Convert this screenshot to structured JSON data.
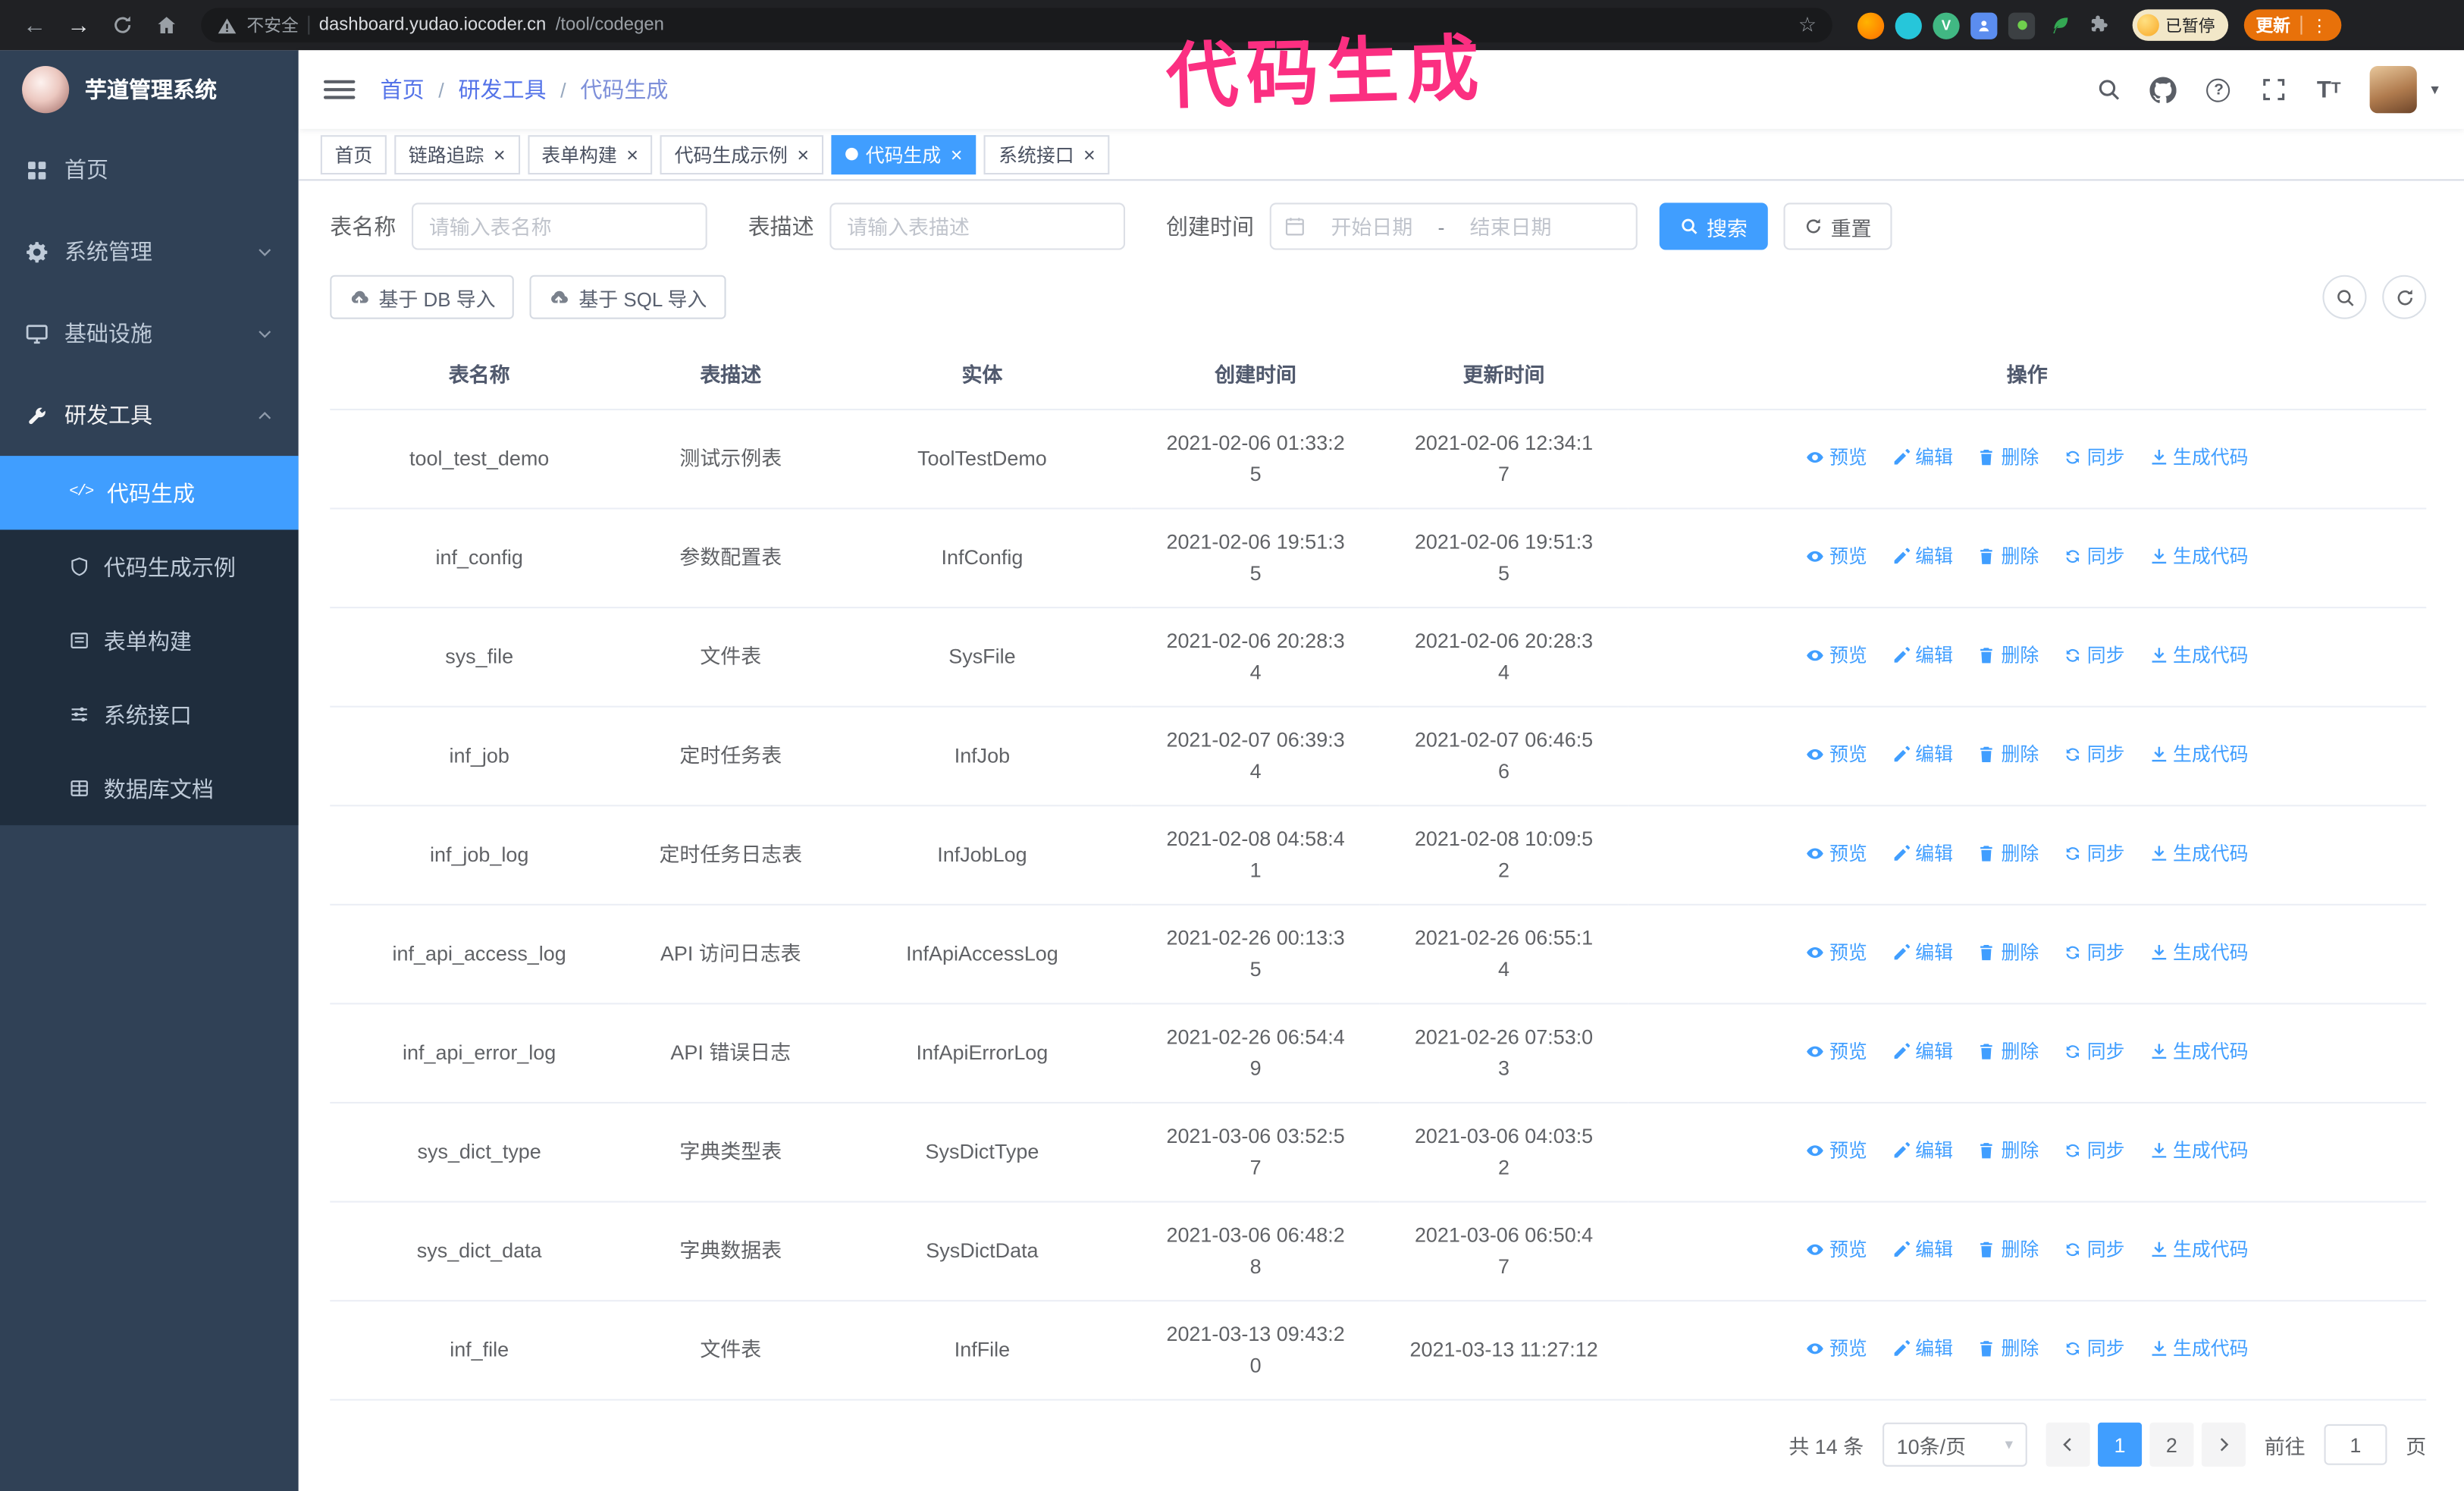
{
  "annotation": {
    "text": "代码生成"
  },
  "browser": {
    "security_label": "不安全",
    "url_host": "dashboard.yudao.iocoder.cn",
    "url_path": "/tool/codegen",
    "paused_badge_label": "已暂停",
    "update_button_label": "更新"
  },
  "icons": {
    "close_glyph": "×",
    "caret_down_glyph": "▾",
    "breadcrumb_separator": "/",
    "back_glyph": "←",
    "forward_glyph": "→",
    "kebab_glyph": "⋮",
    "star_glyph": "☆",
    "code_glyph": "</>"
  },
  "sidebar": {
    "logo_title": "芋道管理系统",
    "items": [
      {
        "label": "首页"
      },
      {
        "label": "系统管理"
      },
      {
        "label": "基础设施"
      },
      {
        "label": "研发工具"
      }
    ],
    "submenu": [
      {
        "label": "代码生成"
      },
      {
        "label": "代码生成示例"
      },
      {
        "label": "表单构建"
      },
      {
        "label": "系统接口"
      },
      {
        "label": "数据库文档"
      }
    ]
  },
  "topbar": {
    "breadcrumb": [
      "首页",
      "研发工具",
      "代码生成"
    ]
  },
  "tabs": [
    {
      "label": "首页"
    },
    {
      "label": "链路追踪"
    },
    {
      "label": "表单构建"
    },
    {
      "label": "代码生成示例"
    },
    {
      "label": "代码生成"
    },
    {
      "label": "系统接口"
    }
  ],
  "filters": {
    "table_name_label": "表名称",
    "table_name_placeholder": "请输入表名称",
    "table_desc_label": "表描述",
    "table_desc_placeholder": "请输入表描述",
    "create_time_label": "创建时间",
    "date_start_placeholder": "开始日期",
    "date_separator": "-",
    "date_end_placeholder": "结束日期",
    "search_button_label": "搜索",
    "reset_button_label": "重置"
  },
  "toolbar": {
    "import_db_label": "基于 DB 导入",
    "import_sql_label": "基于 SQL 导入"
  },
  "table": {
    "columns": [
      "表名称",
      "表描述",
      "实体",
      "创建时间",
      "更新时间",
      "操作"
    ],
    "actions": [
      "预览",
      "编辑",
      "删除",
      "同步",
      "生成代码"
    ],
    "rows": [
      {
        "name": "tool_test_demo",
        "desc": "测试示例表",
        "entity": "ToolTestDemo",
        "created": "2021-02-06 01:33:25",
        "updated": "2021-02-06 12:34:17"
      },
      {
        "name": "inf_config",
        "desc": "参数配置表",
        "entity": "InfConfig",
        "created": "2021-02-06 19:51:35",
        "updated": "2021-02-06 19:51:35"
      },
      {
        "name": "sys_file",
        "desc": "文件表",
        "entity": "SysFile",
        "created": "2021-02-06 20:28:34",
        "updated": "2021-02-06 20:28:34"
      },
      {
        "name": "inf_job",
        "desc": "定时任务表",
        "entity": "InfJob",
        "created": "2021-02-07 06:39:34",
        "updated": "2021-02-07 06:46:56"
      },
      {
        "name": "inf_job_log",
        "desc": "定时任务日志表",
        "entity": "InfJobLog",
        "created": "2021-02-08 04:58:41",
        "updated": "2021-02-08 10:09:52"
      },
      {
        "name": "inf_api_access_log",
        "desc": "API 访问日志表",
        "entity": "InfApiAccessLog",
        "created": "2021-02-26 00:13:35",
        "updated": "2021-02-26 06:55:14"
      },
      {
        "name": "inf_api_error_log",
        "desc": "API 错误日志",
        "entity": "InfApiErrorLog",
        "created": "2021-02-26 06:54:49",
        "updated": "2021-02-26 07:53:03"
      },
      {
        "name": "sys_dict_type",
        "desc": "字典类型表",
        "entity": "SysDictType",
        "created": "2021-03-06 03:52:57",
        "updated": "2021-03-06 04:03:52"
      },
      {
        "name": "sys_dict_data",
        "desc": "字典数据表",
        "entity": "SysDictData",
        "created": "2021-03-06 06:48:28",
        "updated": "2021-03-06 06:50:47"
      },
      {
        "name": "inf_file",
        "desc": "文件表",
        "entity": "InfFile",
        "created": "2021-03-13 09:43:20",
        "updated": "2021-03-13 11:27:12"
      }
    ]
  },
  "pagination": {
    "total_label": "共 14 条",
    "page_size_label": "10条/页",
    "page_1": "1",
    "page_2": "2",
    "goto_label": "前往",
    "goto_value": "1",
    "goto_suffix_label": "页"
  }
}
